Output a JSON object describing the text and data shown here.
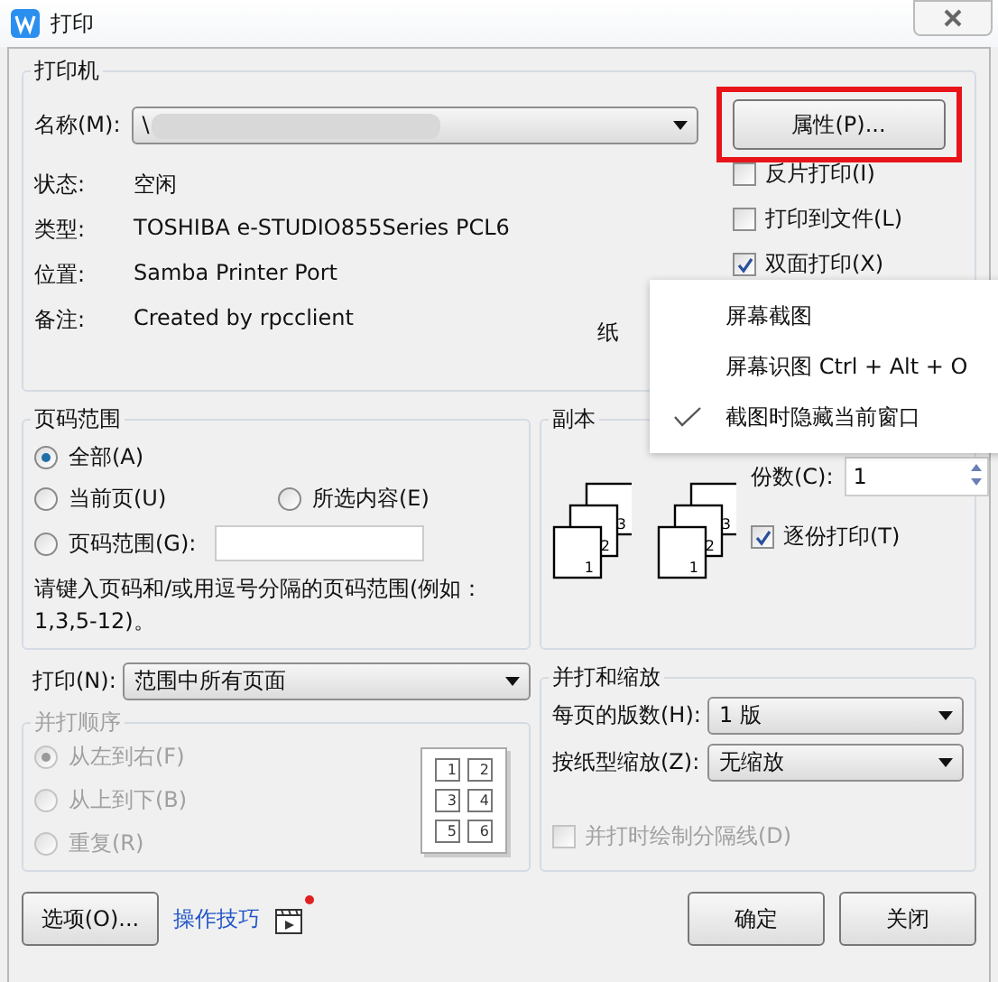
{
  "window": {
    "title": "打印"
  },
  "printer": {
    "title": "打印机",
    "name_label": "名称(M):",
    "name_value": "\\",
    "properties_button": {
      "label": "属性(P)...",
      "highlighted": true
    },
    "info": [
      {
        "label": "状态:",
        "value": "空闲"
      },
      {
        "label": "类型:",
        "value": "TOSHIBA e-STUDIO855Series PCL6"
      },
      {
        "label": "位置:",
        "value": "Samba Printer Port"
      },
      {
        "label": "备注:",
        "value": "Created by rpcclient"
      }
    ],
    "options": [
      {
        "label": "反片打印(I)",
        "checked": false
      },
      {
        "label": "打印到文件(L)",
        "checked": false
      },
      {
        "label": "双面打印(X)",
        "checked": true
      }
    ],
    "paper_label_fragment": "纸"
  },
  "context_menu": {
    "items": [
      {
        "label": "屏幕截图",
        "checked": false
      },
      {
        "label": "屏幕识图 Ctrl + Alt + O",
        "checked": false
      },
      {
        "label": "截图时隐藏当前窗口",
        "checked": true
      }
    ]
  },
  "page_range": {
    "title": "页码范围",
    "options": [
      {
        "label": "全部(A)",
        "selected": true
      },
      {
        "label": "当前页(U)",
        "selected": false
      },
      {
        "label": "所选内容(E)",
        "selected": false
      },
      {
        "label": "页码范围(G):",
        "selected": false
      }
    ],
    "hint": "请键入页码和/或用逗号分隔的页码范围(例如：1,3,5-12)。"
  },
  "copies": {
    "title": "副本",
    "count_label": "份数(C):",
    "count_value": "1",
    "collate": {
      "label": "逐份打印(T)",
      "checked": true
    },
    "page_stacks": [
      [
        "1",
        "2",
        "3"
      ],
      [
        "1",
        "2",
        "3"
      ]
    ]
  },
  "print_what": {
    "label": "打印(N):",
    "value": "范围中所有页面"
  },
  "order": {
    "title": "并打顺序",
    "disabled": true,
    "options": [
      {
        "label": "从左到右(F)",
        "selected": true
      },
      {
        "label": "从上到下(B)",
        "selected": false
      },
      {
        "label": "重复(R)",
        "selected": false
      }
    ],
    "preview_numbers": [
      "1",
      "2",
      "3",
      "4",
      "5",
      "6"
    ]
  },
  "zoom": {
    "title": "并打和缩放",
    "pages_per_sheet_label": "每页的版数(H):",
    "pages_per_sheet_value": "1 版",
    "scale_label": "按纸型缩放(Z):",
    "scale_value": "无缩放",
    "draw_borders": {
      "label": "并打时绘制分隔线(D)",
      "checked": false,
      "disabled": true
    }
  },
  "footer": {
    "options_button": "选项(O)...",
    "tips_link": "操作技巧",
    "tips_new": true,
    "ok_button": "确定",
    "close_button": "关闭"
  }
}
